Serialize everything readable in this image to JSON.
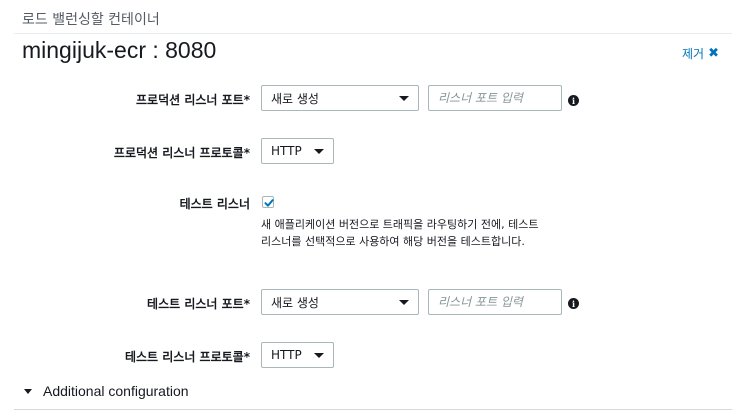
{
  "section_label": "로드 밸런싱할 컨테이너",
  "container_title": "mingijuk-ecr : 8080",
  "remove_label": "제거",
  "production_port": {
    "label": "프로덕션 리스너 포트*",
    "select_value": "새로 생성",
    "input_placeholder": "리스너 포트 입력",
    "info_icon": "info-icon"
  },
  "production_protocol": {
    "label": "프로덕션 리스너 프로토콜*",
    "select_value": "HTTP"
  },
  "test_listener": {
    "label": "테스트 리스너",
    "checked": true,
    "help_line1": "새 애플리케이션 버전으로 트래픽을 라우팅하기 전에, 테스트",
    "help_line2": "리스너를 선택적으로 사용하여 해당 버전을 테스트합니다."
  },
  "test_port": {
    "label": "테스트 리스너 포트*",
    "select_value": "새로 생성",
    "input_placeholder": "리스너 포트 입력",
    "info_icon": "info-icon"
  },
  "test_protocol": {
    "label": "테스트 리스너 프로토콜*",
    "select_value": "HTTP"
  },
  "additional_configuration": "Additional configuration",
  "colors": {
    "link": "#0073bb",
    "checkbox_check": "#0073bb",
    "border": "#aab7b8",
    "text": "#16191f"
  }
}
